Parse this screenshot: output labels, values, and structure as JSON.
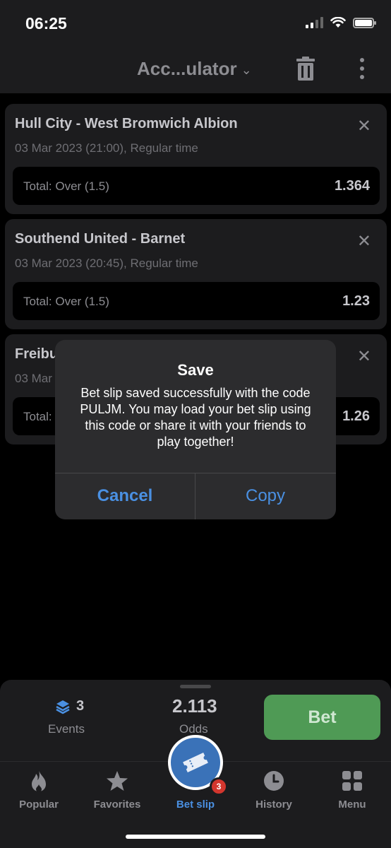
{
  "status_bar": {
    "time": "06:25"
  },
  "header": {
    "title": "Acc...ulator",
    "icons": [
      "chevron-down-icon",
      "trash-icon",
      "kebab-menu-icon"
    ]
  },
  "bets": [
    {
      "match": "Hull City - West Bromwich Albion",
      "date": "03 Mar 2023 (21:00), Regular time",
      "market": "Total: Over (1.5)",
      "odd": "1.364"
    },
    {
      "match": "Southend United - Barnet",
      "date": "03 Mar 2023 (20:45), Regular time",
      "market": "Total: Over (1.5)",
      "odd": "1.23"
    },
    {
      "match": "Freibu",
      "date": "03 Mar",
      "market": "Total:",
      "odd": "1.26"
    }
  ],
  "dialog": {
    "title": "Save",
    "message": "Bet slip saved successfully with the code PULJM. You may load your bet slip using this code or share it with your friends to play together!",
    "cancel_label": "Cancel",
    "copy_label": "Copy"
  },
  "summary": {
    "events_count": "3",
    "events_label": "Events",
    "odds_value": "2.113",
    "odds_label": "Odds",
    "bet_label": "Bet"
  },
  "tabs": [
    {
      "label": "Popular",
      "icon": "flame-icon"
    },
    {
      "label": "Favorites",
      "icon": "star-icon"
    },
    {
      "label": "Bet slip",
      "icon": "ticket-icon",
      "badge": "3"
    },
    {
      "label": "History",
      "icon": "clock-icon"
    },
    {
      "label": "Menu",
      "icon": "grid-icon"
    }
  ],
  "colors": {
    "accent": "#4a90e2",
    "bet_button": "#4f9a55",
    "badge": "#d3362e",
    "background": "#000000",
    "surface": "#1c1c1e"
  }
}
